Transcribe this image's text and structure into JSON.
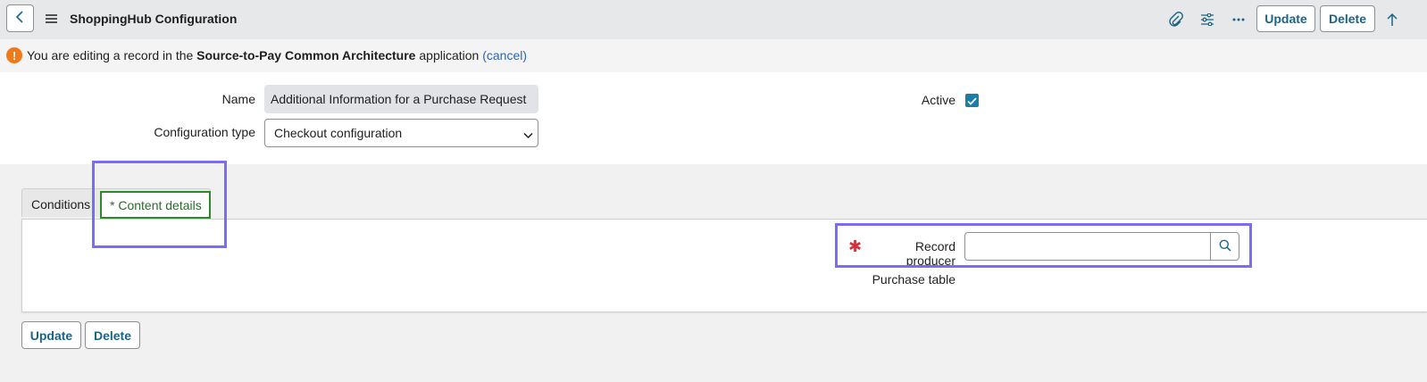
{
  "header": {
    "title": "ShoppingHub Configuration",
    "update_label": "Update",
    "delete_label": "Delete"
  },
  "banner": {
    "prefix": "You are editing a record in the ",
    "app_name": "Source-to-Pay Common Architecture",
    "suffix": " application ",
    "cancel_link": "(cancel)"
  },
  "form": {
    "name_label": "Name",
    "name_value": "Additional Information for a Purchase Request",
    "config_type_label": "Configuration type",
    "config_type_value": "Checkout configuration",
    "active_label": "Active",
    "active_checked": true
  },
  "tabs": [
    {
      "label": "Conditions"
    },
    {
      "label": "* Content details"
    }
  ],
  "content_details": {
    "required_marker": "✱",
    "record_producer_label": "Record producer",
    "record_producer_value": "",
    "purchase_table_label": "Purchase table"
  },
  "footer": {
    "update_label": "Update",
    "delete_label": "Delete"
  },
  "colors": {
    "accent": "#1b6483",
    "highlight": "#7b6cf6",
    "active_tab_border": "#2c8a2c",
    "warning": "#f07a1a",
    "required": "#d1333c"
  }
}
